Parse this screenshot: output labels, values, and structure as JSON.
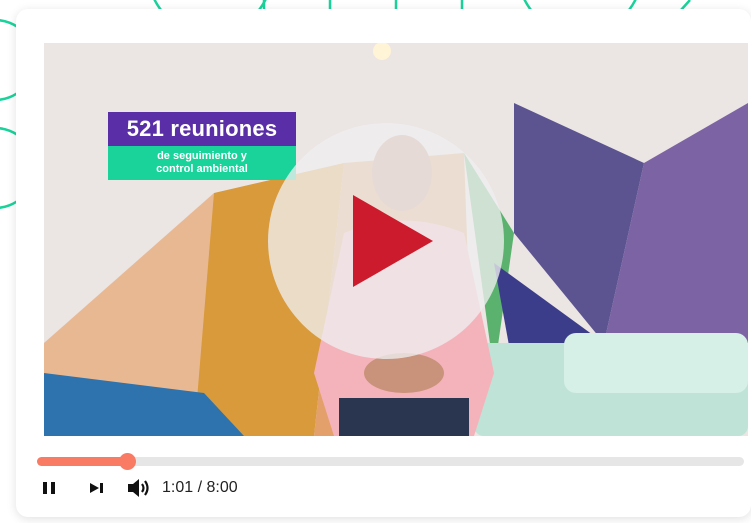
{
  "video": {
    "overlay_title": "521 reuniones",
    "overlay_subtitle": "de seguimiento y\ncontrol ambiental"
  },
  "player": {
    "current_time": "1:01",
    "duration": "8:00",
    "time_display": "1:01 / 8:00",
    "progress": 0.127
  },
  "icons": {
    "play": "play-icon",
    "pause": "pause-icon",
    "next": "skip-next-icon",
    "volume": "volume-icon"
  },
  "colors": {
    "accent": "#f97b64",
    "play_triangle": "#cc1b2c",
    "overlay_purple": "#5a2ea6",
    "overlay_green": "#19d39a",
    "decor_green": "#19d39a"
  }
}
